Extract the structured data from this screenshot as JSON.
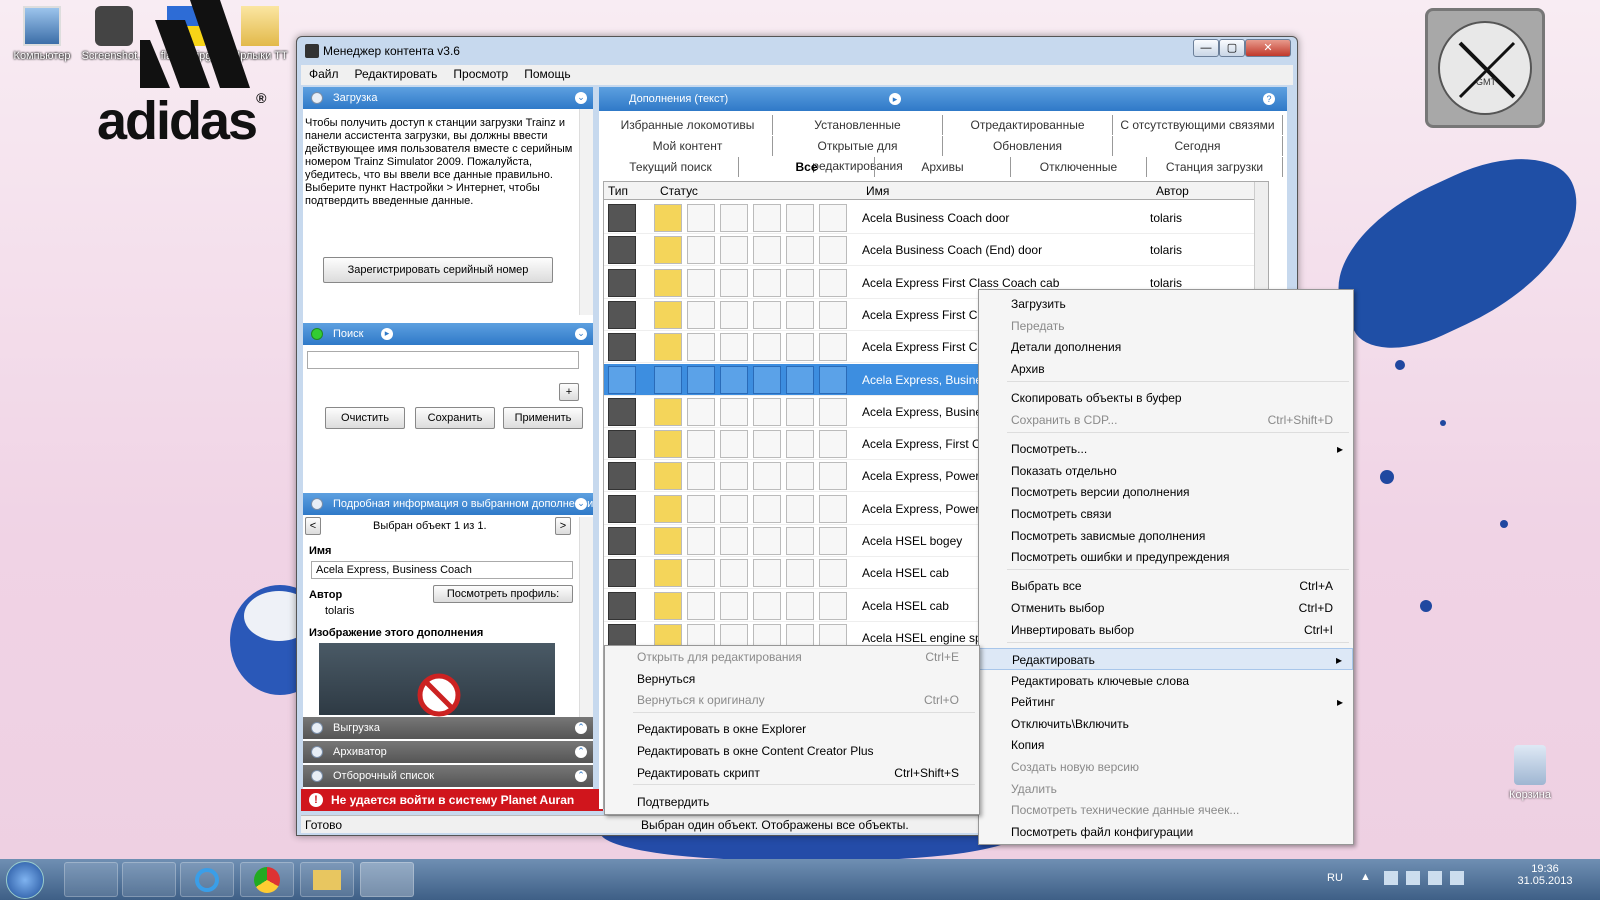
{
  "desktop": {
    "icons": [
      {
        "label": "Компьютер"
      },
      {
        "label": "Screenshot..."
      },
      {
        "label": "flagUA.jpg"
      },
      {
        "label": "Ярлыки TT"
      }
    ],
    "logo_text": "adidas",
    "clock_label": "GMT",
    "recycle_label": "Корзина"
  },
  "window": {
    "title": "Менеджер контента v3.6",
    "controls": {
      "minimize": "—",
      "maximize": "▢",
      "close": "✕"
    },
    "menu": [
      "Файл",
      "Редактировать",
      "Просмотр",
      "Помощь"
    ]
  },
  "download_panel": {
    "title": "Загрузка",
    "text": "Чтобы получить доступ к станции загрузки Trainz и панели ассистента загрузки, вы должны ввести действующее имя пользователя вместе с серийным номером Trainz Simulator 2009. Пожалуйста, убедитесь, что вы ввели все данные правильно. Выберите пункт Настройки > Интернет, чтобы подтвердить введенные данные.",
    "register_button": "Зарегистрировать серийный номер"
  },
  "search_panel": {
    "title": "Поиск",
    "input_value": "",
    "add_label": "+",
    "clear": "Очистить",
    "save": "Сохранить",
    "apply": "Применить"
  },
  "details_panel": {
    "title": "Подробная информация о выбранном дополнении",
    "nav_prev": "<",
    "nav_next": ">",
    "selected": "Выбран объект  1  из 1.",
    "name_label": "Имя",
    "name_value": "Acela Express, Business Coach",
    "author_label": "Автор",
    "author_value": "tolaris",
    "profile_button": "Посмотреть профиль:",
    "image_label": "Изображение этого дополнения"
  },
  "collapsed_panels": [
    "Выгрузка",
    "Архиватор",
    "Отборочный список"
  ],
  "error_text": "Не удается войти в систему Planet Auran",
  "content_panel": {
    "title": "Дополнения (текст)",
    "help": "?",
    "tabs_row1": [
      "Избранные локомотивы",
      "Установленные",
      "Отредактированные",
      "С отсутствующими связями"
    ],
    "tabs_row2": [
      "Мой контент",
      "Открытые для редактирования",
      "Обновления",
      "Сегодня"
    ],
    "tabs_row3": [
      "Текущий поиск",
      "Все",
      "Архивы",
      "Отключенные",
      "Станция загрузки"
    ],
    "columns": {
      "type": "Тип",
      "status": "Статус",
      "name": "Имя",
      "author": "Автор"
    },
    "rows": [
      {
        "name": "Acela Business Coach door",
        "author": "tolaris"
      },
      {
        "name": "Acela Business Coach (End) door",
        "author": "tolaris"
      },
      {
        "name": "Acela Express First Class Coach cab",
        "author": "tolaris"
      },
      {
        "name": "Acela Express First Cla",
        "author": ""
      },
      {
        "name": "Acela Express First Cla",
        "author": ""
      },
      {
        "name": "Acela Express, Busine",
        "author": ""
      },
      {
        "name": "Acela Express, Busine",
        "author": ""
      },
      {
        "name": "Acela Express, First Cl",
        "author": ""
      },
      {
        "name": "Acela Express, Power",
        "author": ""
      },
      {
        "name": "Acela Express, Power",
        "author": ""
      },
      {
        "name": "Acela HSEL bogey",
        "author": ""
      },
      {
        "name": "Acela HSEL cab",
        "author": ""
      },
      {
        "name": "Acela HSEL cab",
        "author": ""
      },
      {
        "name": "Acela HSEL engine sp",
        "author": ""
      }
    ]
  },
  "statusbar": {
    "left": "Готово",
    "right": "Выбран один объект. Отображены все объекты."
  },
  "context_menu": [
    {
      "label": "Загрузить",
      "shortcut": ""
    },
    {
      "label": "Передать",
      "shortcut": ""
    },
    {
      "label": "Детали дополнения",
      "shortcut": ""
    },
    {
      "label": "Архив",
      "shortcut": ""
    },
    {
      "label": "Скопировать объекты в буфер",
      "shortcut": ""
    },
    {
      "label": "Сохранить в CDP...",
      "shortcut": "Ctrl+Shift+D"
    },
    {
      "label": "Посмотреть...",
      "shortcut": ""
    },
    {
      "label": "Показать отдельно",
      "shortcut": ""
    },
    {
      "label": "Посмотреть версии дополнения",
      "shortcut": ""
    },
    {
      "label": "Посмотреть связи",
      "shortcut": ""
    },
    {
      "label": "Посмотреть зависмые дополнения",
      "shortcut": ""
    },
    {
      "label": "Посмотреть ошибки и предупреждения",
      "shortcut": ""
    },
    {
      "label": "Выбрать все",
      "shortcut": "Ctrl+A"
    },
    {
      "label": "Отменить выбор",
      "shortcut": "Ctrl+D"
    },
    {
      "label": "Инвертировать выбор",
      "shortcut": "Ctrl+I"
    },
    {
      "label": "Редактировать",
      "shortcut": ""
    },
    {
      "label": "Редактировать ключевые слова",
      "shortcut": ""
    },
    {
      "label": "Рейтинг",
      "shortcut": ""
    },
    {
      "label": "Отключить\\Включить",
      "shortcut": ""
    },
    {
      "label": "Копия",
      "shortcut": ""
    },
    {
      "label": "Создать новую версию",
      "shortcut": ""
    },
    {
      "label": "Удалить",
      "shortcut": ""
    },
    {
      "label": "Посмотреть технические данные ячеек...",
      "shortcut": ""
    },
    {
      "label": "Посмотреть файл конфигурации",
      "shortcut": ""
    }
  ],
  "submenu": [
    {
      "label": "Открыть для редактирования",
      "shortcut": "Ctrl+E"
    },
    {
      "label": "Вернуться",
      "shortcut": ""
    },
    {
      "label": "Вернуться к оригиналу",
      "shortcut": "Ctrl+O"
    },
    {
      "label": "Редактировать в окне Explorer",
      "shortcut": ""
    },
    {
      "label": "Редактировать в окне Content Creator Plus",
      "shortcut": ""
    },
    {
      "label": "Редактировать скрипт",
      "shortcut": "Ctrl+Shift+S"
    },
    {
      "label": "Подтвердить",
      "shortcut": ""
    }
  ],
  "taskbar": {
    "lang": "RU",
    "time": "19:36",
    "date": "31.05.2013"
  }
}
